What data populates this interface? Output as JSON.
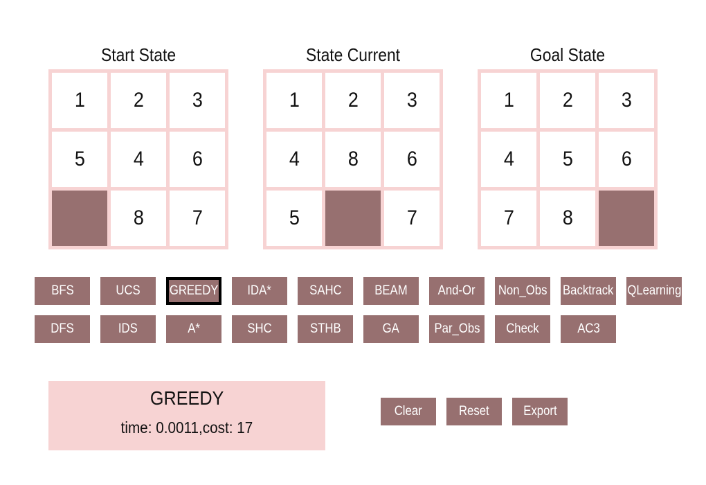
{
  "boards": {
    "start": {
      "title": "Start State",
      "tiles": [
        "1",
        "2",
        "3",
        "5",
        "4",
        "6",
        "",
        "8",
        "7"
      ]
    },
    "current": {
      "title": "State Current",
      "tiles": [
        "1",
        "2",
        "3",
        "4",
        "8",
        "6",
        "5",
        "",
        "7"
      ]
    },
    "goal": {
      "title": "Goal State",
      "tiles": [
        "1",
        "2",
        "3",
        "4",
        "5",
        "6",
        "7",
        "8",
        ""
      ]
    }
  },
  "algorithms": {
    "row1": [
      "BFS",
      "UCS",
      "GREEDY",
      "IDA*",
      "SAHC",
      "BEAM",
      "And-Or",
      "Non_Obs",
      "Backtrack",
      "QLearning"
    ],
    "row2": [
      "DFS",
      "IDS",
      "A*",
      "SHC",
      "STHB",
      "GA",
      "Par_Obs",
      "Check",
      "AC3"
    ]
  },
  "selected_algorithm": "GREEDY",
  "result": {
    "title": "GREEDY",
    "info": "time: 0.0011,cost: 17"
  },
  "actions": {
    "clear": "Clear",
    "reset": "Reset",
    "export": "Export"
  },
  "colors": {
    "tile_blank": "#977070",
    "board_bg": "#f7d3d3",
    "button_bg": "#977070",
    "button_text": "#ffffff"
  }
}
